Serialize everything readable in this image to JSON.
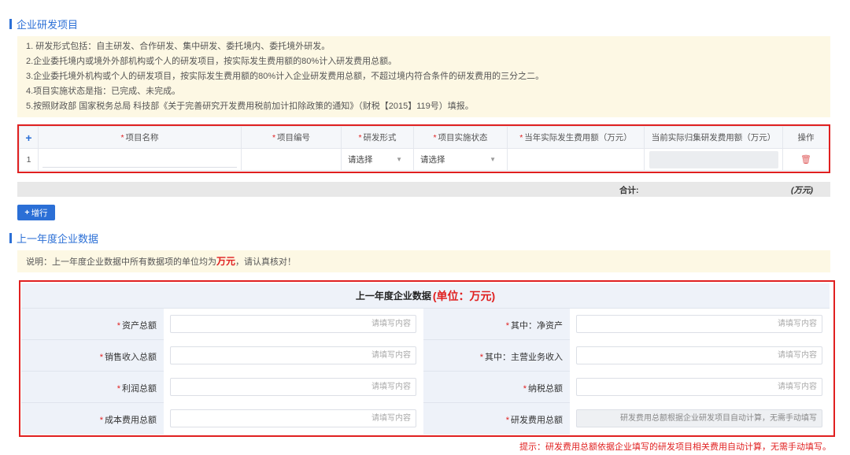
{
  "section1": {
    "title": "企业研发项目",
    "notes": [
      "1. 研发形式包括：自主研发、合作研发、集中研发、委托境内、委托境外研发。",
      "2.企业委托境内或境外外部机构或个人的研发项目，按实际发生费用额的80%计入研发费用总额。",
      "3.企业委托境外机构或个人的研发项目，按实际发生费用额的80%计入企业研发费用总额，不超过境内符合条件的研发费用的三分之二。",
      "4.项目实施状态是指：已完成、未完成。",
      "5.按照财政部 国家税务总局 科技部《关于完善研究开发费用税前加计扣除政策的通知》（财税【2015】119号）填报。"
    ]
  },
  "table": {
    "add_symbol": "+",
    "columns": [
      {
        "label": "项目名称",
        "required": true
      },
      {
        "label": "项目编号",
        "required": true
      },
      {
        "label": "研发形式",
        "required": true
      },
      {
        "label": "项目实施状态",
        "required": true
      },
      {
        "label": "当年实际发生费用额（万元）",
        "required": true
      },
      {
        "label": "当前实际归集研发费用额（万元）",
        "required": false
      },
      {
        "label": "操作",
        "required": false
      }
    ],
    "rows": [
      {
        "index": "1",
        "form_select": "请选择",
        "status_select": "请选择"
      }
    ],
    "sum_label": "合计:",
    "sum_unit": "(万元)"
  },
  "add_row_label": "增行",
  "section2": {
    "title": "上一年度企业数据",
    "note_prefix": "说明：上一年度企业数据中所有数据项的单位均为",
    "note_em": "万元",
    "note_suffix": "，请认真核对！",
    "form_title": "上一年度企业数据",
    "form_unit": "(单位：万元)",
    "placeholder": "请填写内容",
    "fields_left": [
      "资产总额",
      "销售收入总额",
      "利润总额",
      "成本费用总额"
    ],
    "fields_right": [
      "其中：净资产",
      "其中：主营业务收入",
      "纳税总额",
      "研发费用总额"
    ],
    "auto_calc_text": "研发费用总额根据企业研发项目自动计算，无需手动填写"
  },
  "hint": "提示：研发费用总额依据企业填写的研发项目相关费用自动计算，无需手动填写。",
  "colors": {
    "accent": "#2b6fd6",
    "alert": "#e02020",
    "notice_bg": "#fdf8e4"
  }
}
